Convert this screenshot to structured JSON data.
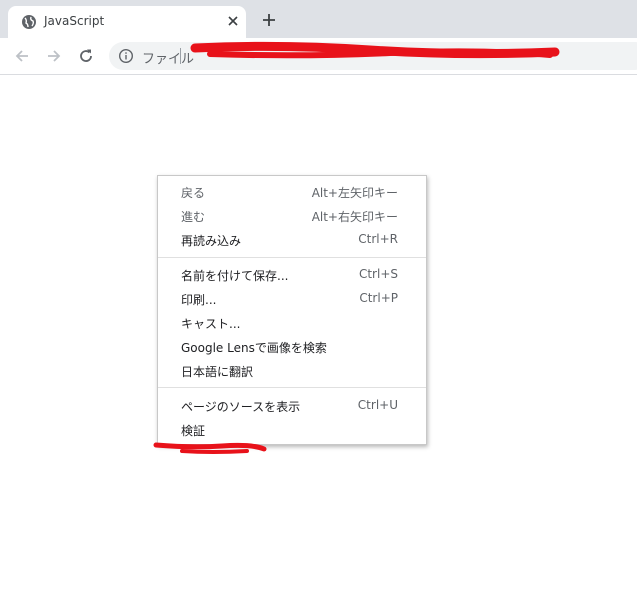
{
  "browser": {
    "tab": {
      "title": "JavaScript",
      "favicon_icon": "globe-icon",
      "close_icon": "close-icon"
    },
    "new_tab_icon": "plus-icon",
    "toolbar": {
      "back_icon": "arrow-left-icon",
      "forward_icon": "arrow-right-icon",
      "reload_icon": "reload-icon",
      "info_icon": "info-icon",
      "scheme_label": "ファイル"
    },
    "redaction_color": "#e8121a"
  },
  "context_menu": {
    "groups": [
      [
        {
          "label": "戻る",
          "shortcut": "Alt+左矢印キー"
        },
        {
          "label": "進む",
          "shortcut": "Alt+右矢印キー"
        },
        {
          "label": "再読み込み",
          "shortcut": "Ctrl+R"
        }
      ],
      [
        {
          "label": "名前を付けて保存...",
          "shortcut": "Ctrl+S"
        },
        {
          "label": "印刷...",
          "shortcut": "Ctrl+P"
        },
        {
          "label": "キャスト...",
          "shortcut": ""
        },
        {
          "label": "Google Lensで画像を検索",
          "shortcut": ""
        },
        {
          "label": "日本語に翻訳",
          "shortcut": ""
        }
      ],
      [
        {
          "label": "ページのソースを表示",
          "shortcut": "Ctrl+U"
        },
        {
          "label": "検証",
          "shortcut": ""
        }
      ]
    ]
  }
}
